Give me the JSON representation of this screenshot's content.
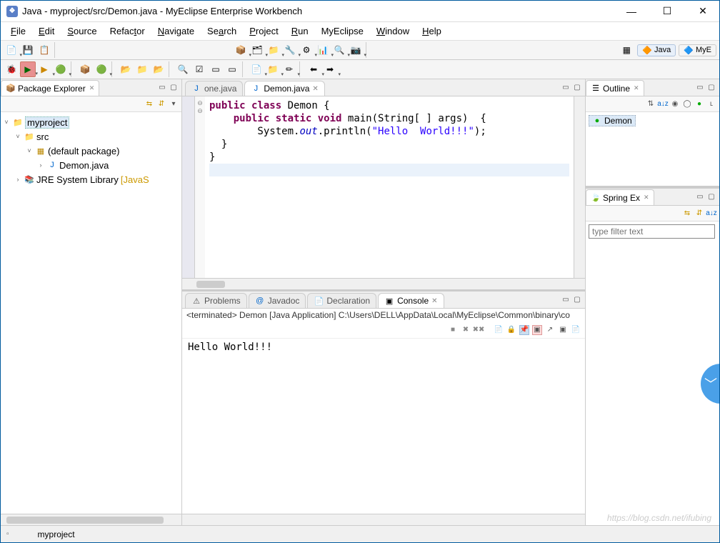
{
  "titlebar": {
    "title": "Java - myproject/src/Demon.java - MyEclipse Enterprise Workbench"
  },
  "menu": [
    "File",
    "Edit",
    "Source",
    "Refactor",
    "Navigate",
    "Search",
    "Project",
    "Run",
    "MyEclipse",
    "Window",
    "Help"
  ],
  "perspectives": {
    "java": "Java",
    "mye": "MyE"
  },
  "package_explorer": {
    "title": "Package Explorer",
    "root": "myproject",
    "src": "src",
    "pkg": "(default package)",
    "file": "Demon.java",
    "jre": "JRE System Library",
    "jre_suffix": "[JavaS"
  },
  "editor": {
    "tabs": {
      "inactive": "one.java",
      "active": "Demon.java"
    },
    "code": {
      "l1a": "public",
      "l1b": "class",
      "l1c": " Demon {",
      "l2a": "public",
      "l2b": "static",
      "l2c": "void",
      "l2d": " main(String[ ] args)  {",
      "l3a": "        System.",
      "l3b": "out",
      "l3c": ".println(",
      "l3d": "\"Hello  World!!!\"",
      "l3e": ");",
      "l4": "  }",
      "l5": "}"
    }
  },
  "bottom_tabs": {
    "problems": "Problems",
    "javadoc": "Javadoc",
    "declaration": "Declaration",
    "console": "Console"
  },
  "console": {
    "status": "<terminated> Demon [Java Application] C:\\Users\\DELL\\AppData\\Local\\MyEclipse\\Common\\binary\\co",
    "output": "Hello  World!!!"
  },
  "outline": {
    "title": "Outline",
    "item": "Demon"
  },
  "spring": {
    "title": "Spring Ex",
    "filter_placeholder": "type filter text"
  },
  "status": {
    "project": "myproject",
    "watermark": "https://blog.csdn.net/ifubing"
  }
}
